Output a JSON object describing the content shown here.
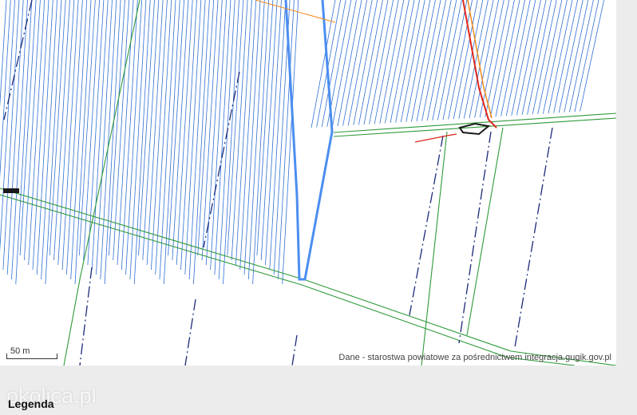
{
  "map": {
    "scale_label": "50 m",
    "attribution": "Dane - starostwa powiatowe za pośrednictwem integracja.gugik.gov.pl",
    "colors": {
      "parcel_lines": "#2f6fd6",
      "road_edges": "#2e9a3a",
      "plot_outline": "#4b8ef0",
      "boundary_dashed": "#1a2a7a",
      "utility_red": "#e0261c",
      "utility_orange": "#f08a1c"
    }
  },
  "legend": {
    "title": "Legenda"
  },
  "watermark": {
    "text": "okolica.pl"
  }
}
